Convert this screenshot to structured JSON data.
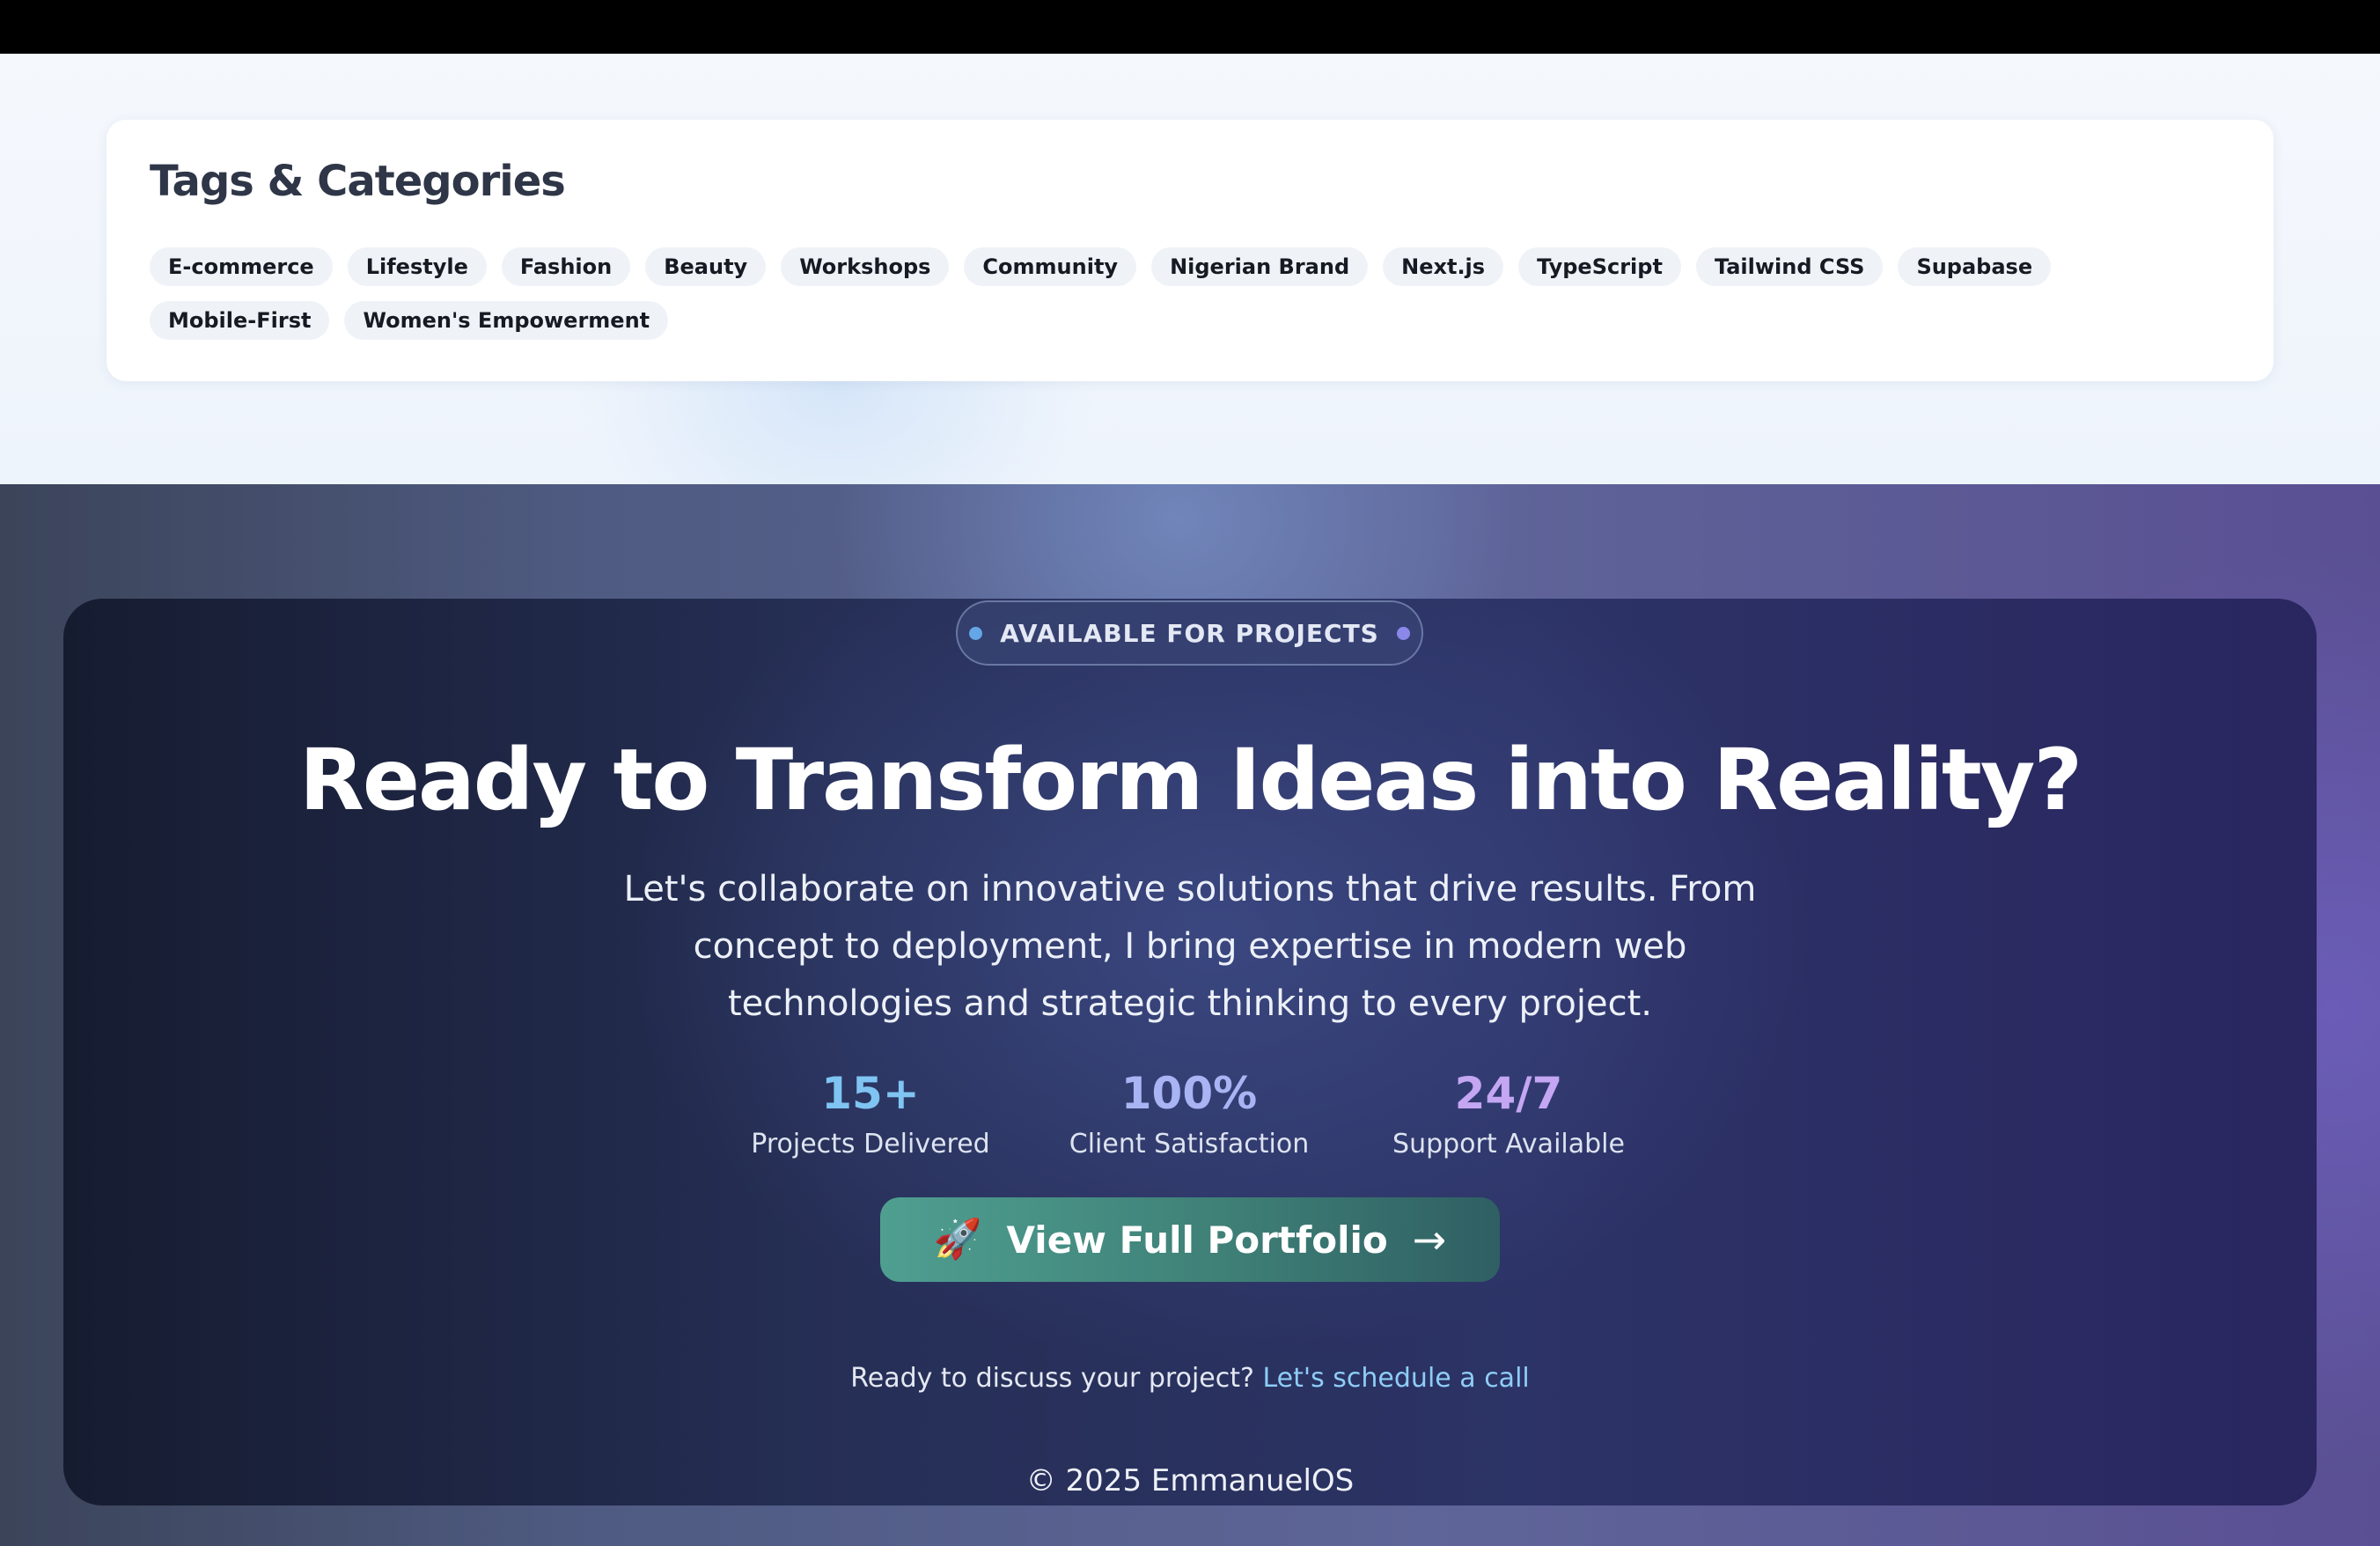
{
  "tags_section": {
    "title": "Tags & Categories",
    "tags": [
      "E-commerce",
      "Lifestyle",
      "Fashion",
      "Beauty",
      "Workshops",
      "Community",
      "Nigerian Brand",
      "Next.js",
      "TypeScript",
      "Tailwind CSS",
      "Supabase",
      "Mobile-First",
      "Women's Empowerment"
    ]
  },
  "cta": {
    "badge": "AVAILABLE FOR PROJECTS",
    "headline": "Ready to Transform Ideas into Reality?",
    "subtitle": "Let's collaborate on innovative solutions that drive results. From concept to deployment, I bring expertise in modern web technologies and strategic thinking to every project.",
    "stats": [
      {
        "value": "15+",
        "label": "Projects Delivered"
      },
      {
        "value": "100%",
        "label": "Client Satisfaction"
      },
      {
        "value": "24/7",
        "label": "Support Available"
      }
    ],
    "button": {
      "icon": "rocket-icon",
      "label": "View Full Portfolio",
      "arrow": "→"
    },
    "discuss_text": "Ready to discuss your project?",
    "discuss_link": "Let's schedule a call",
    "copyright": "© 2025 EmmanuelOS"
  },
  "colors": {
    "tag_bg": "#eff2f7",
    "button_start": "#4f9f91",
    "button_end": "#2f5f63",
    "link": "#8ecdf6",
    "stat_1": "#7fc4f2",
    "stat_2": "#a8b4f3",
    "stat_3": "#c4a6f3"
  }
}
